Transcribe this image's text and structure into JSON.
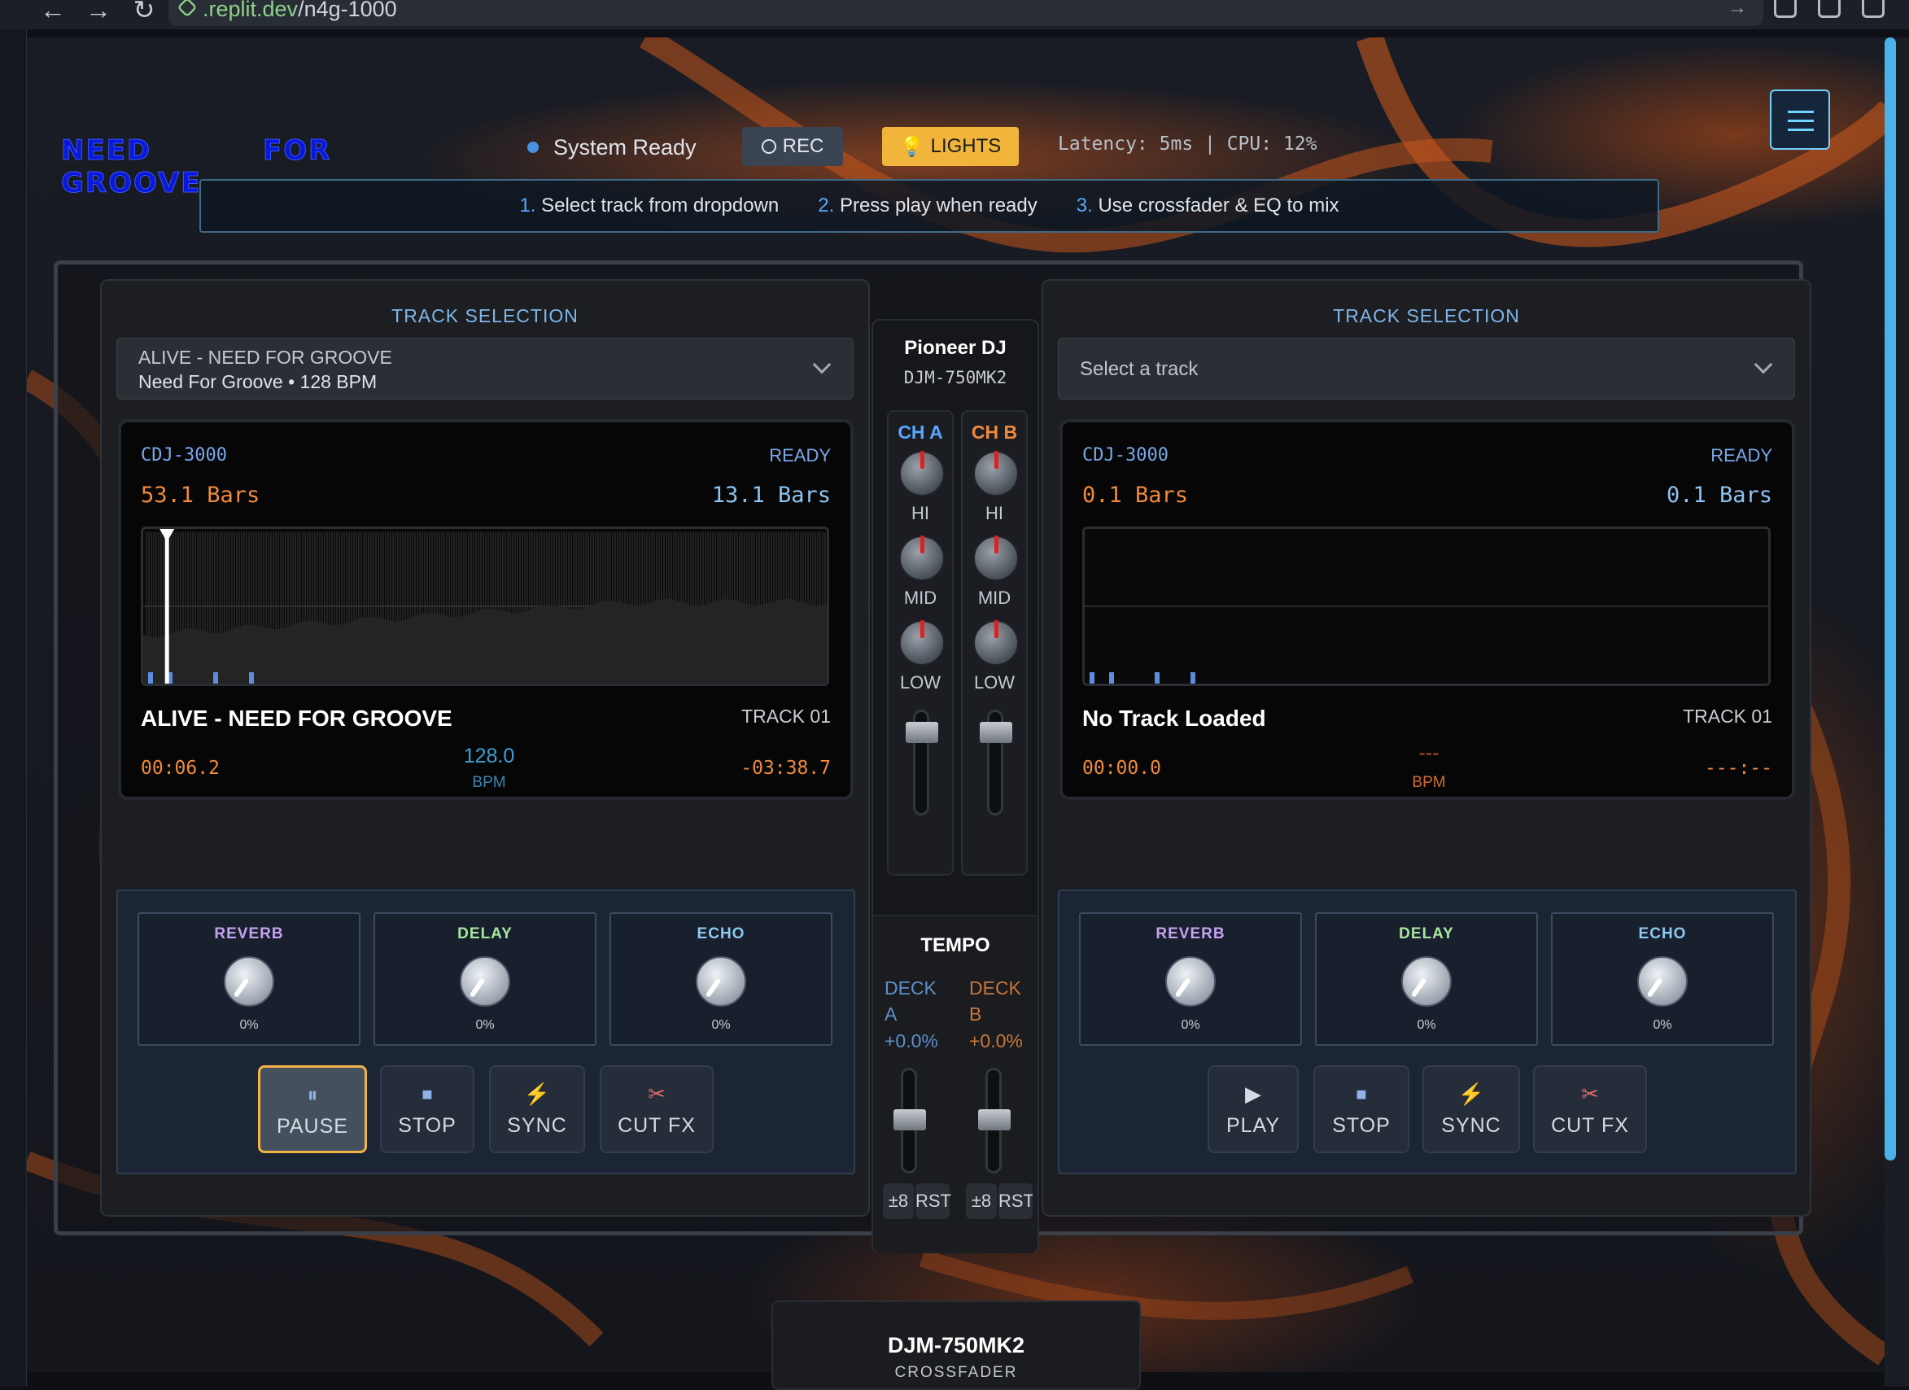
{
  "browser": {
    "url_domain": ".replit.dev",
    "url_path": "/n4g-1000"
  },
  "logo": {
    "word1": "NEED",
    "word2": "GROOVE",
    "word3": "FOR"
  },
  "status": {
    "text": "System Ready",
    "rec": "REC",
    "lights": "LIGHTS",
    "stats": "Latency: 5ms | CPU: 12%"
  },
  "instructions": [
    {
      "num": "1.",
      "text": "Select track from dropdown"
    },
    {
      "num": "2.",
      "text": "Press play when ready"
    },
    {
      "num": "3.",
      "text": "Use crossfader & EQ to mix"
    }
  ],
  "deck_a": {
    "selection_label": "TRACK SELECTION",
    "selected_title": "ALIVE - NEED FOR GROOVE",
    "selected_meta": "Need For Groove • 128 BPM",
    "player": "CDJ-3000",
    "state": "READY",
    "bars_left": "53.1 Bars",
    "bars_right": "13.1 Bars",
    "track_title": "ALIVE - NEED FOR GROOVE",
    "track_number": "TRACK 01",
    "elapsed": "00:06.2",
    "remaining": "-03:38.7",
    "bpm": "128.0",
    "bpm_label": "BPM",
    "playhead_fraction": 0.03,
    "fx": [
      {
        "name": "REVERB",
        "value": "0%"
      },
      {
        "name": "DELAY",
        "value": "0%"
      },
      {
        "name": "ECHO",
        "value": "0%"
      }
    ],
    "buttons": [
      "PAUSE",
      "STOP",
      "SYNC",
      "CUT FX"
    ]
  },
  "deck_b": {
    "selection_label": "TRACK SELECTION",
    "placeholder": "Select a track",
    "player": "CDJ-3000",
    "state": "READY",
    "bars_left": "0.1 Bars",
    "bars_right": "0.1 Bars",
    "track_title": "No Track Loaded",
    "track_number": "TRACK 01",
    "elapsed": "00:00.0",
    "remaining": "---:--",
    "bpm": "---",
    "bpm_label": "BPM",
    "fx": [
      {
        "name": "REVERB",
        "value": "0%"
      },
      {
        "name": "DELAY",
        "value": "0%"
      },
      {
        "name": "ECHO",
        "value": "0%"
      }
    ],
    "buttons": [
      "PLAY",
      "STOP",
      "SYNC",
      "CUT FX"
    ]
  },
  "mixer": {
    "brand": "Pioneer DJ",
    "model": "DJM-750MK2",
    "ch_a": "CH A",
    "ch_b": "CH B",
    "eq": [
      "HI",
      "MID",
      "LOW"
    ],
    "tempo_title": "TEMPO",
    "deck_a_line1": "DECK",
    "deck_a_line2": "A",
    "deck_b_line1": "DECK",
    "deck_b_line2": "B",
    "tempo_a": "+0.0%",
    "tempo_b": "+0.0%",
    "range_btn": "±8",
    "reset_btn": "RST"
  },
  "crossfader": {
    "title": "DJM-750MK2",
    "subtitle": "CROSSFADER"
  },
  "colors": {
    "accent": "#6fd3ff",
    "orange": "#f08a3c",
    "blue_label": "#7fb6ea",
    "pause_border": "#f3b346",
    "lights": "#f0b53a",
    "reverb": "#c7a2ef",
    "delay": "#a8e6a0",
    "echo": "#8cc8f0"
  },
  "icons": {
    "pause": "pause-icon",
    "stop": "stop-icon",
    "sync": "lightning-icon",
    "cutfx": "scissors-icon",
    "play": "play-icon",
    "menu": "hamburger-icon",
    "lights": "bulb-icon"
  }
}
